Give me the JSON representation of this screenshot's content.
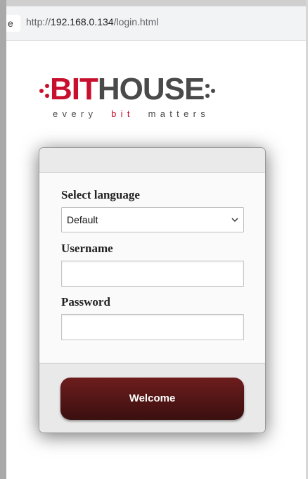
{
  "browser": {
    "tab_stub": "e",
    "url_prefix": "http://",
    "url_host": "192.168.0.134",
    "url_path": "/login.html"
  },
  "logo": {
    "brand_bit": "BIT",
    "brand_house": "HOUSE",
    "tagline_start": "every",
    "tagline_middle": "bit",
    "tagline_end": "matters",
    "accent_color": "#c8102e",
    "text_color": "#4a4a4a"
  },
  "login_form": {
    "language_label": "Select language",
    "language_selected": "Default",
    "username_label": "Username",
    "username_value": "",
    "password_label": "Password",
    "password_value": "",
    "submit_label": "Welcome",
    "button_color": "#5a1818"
  }
}
